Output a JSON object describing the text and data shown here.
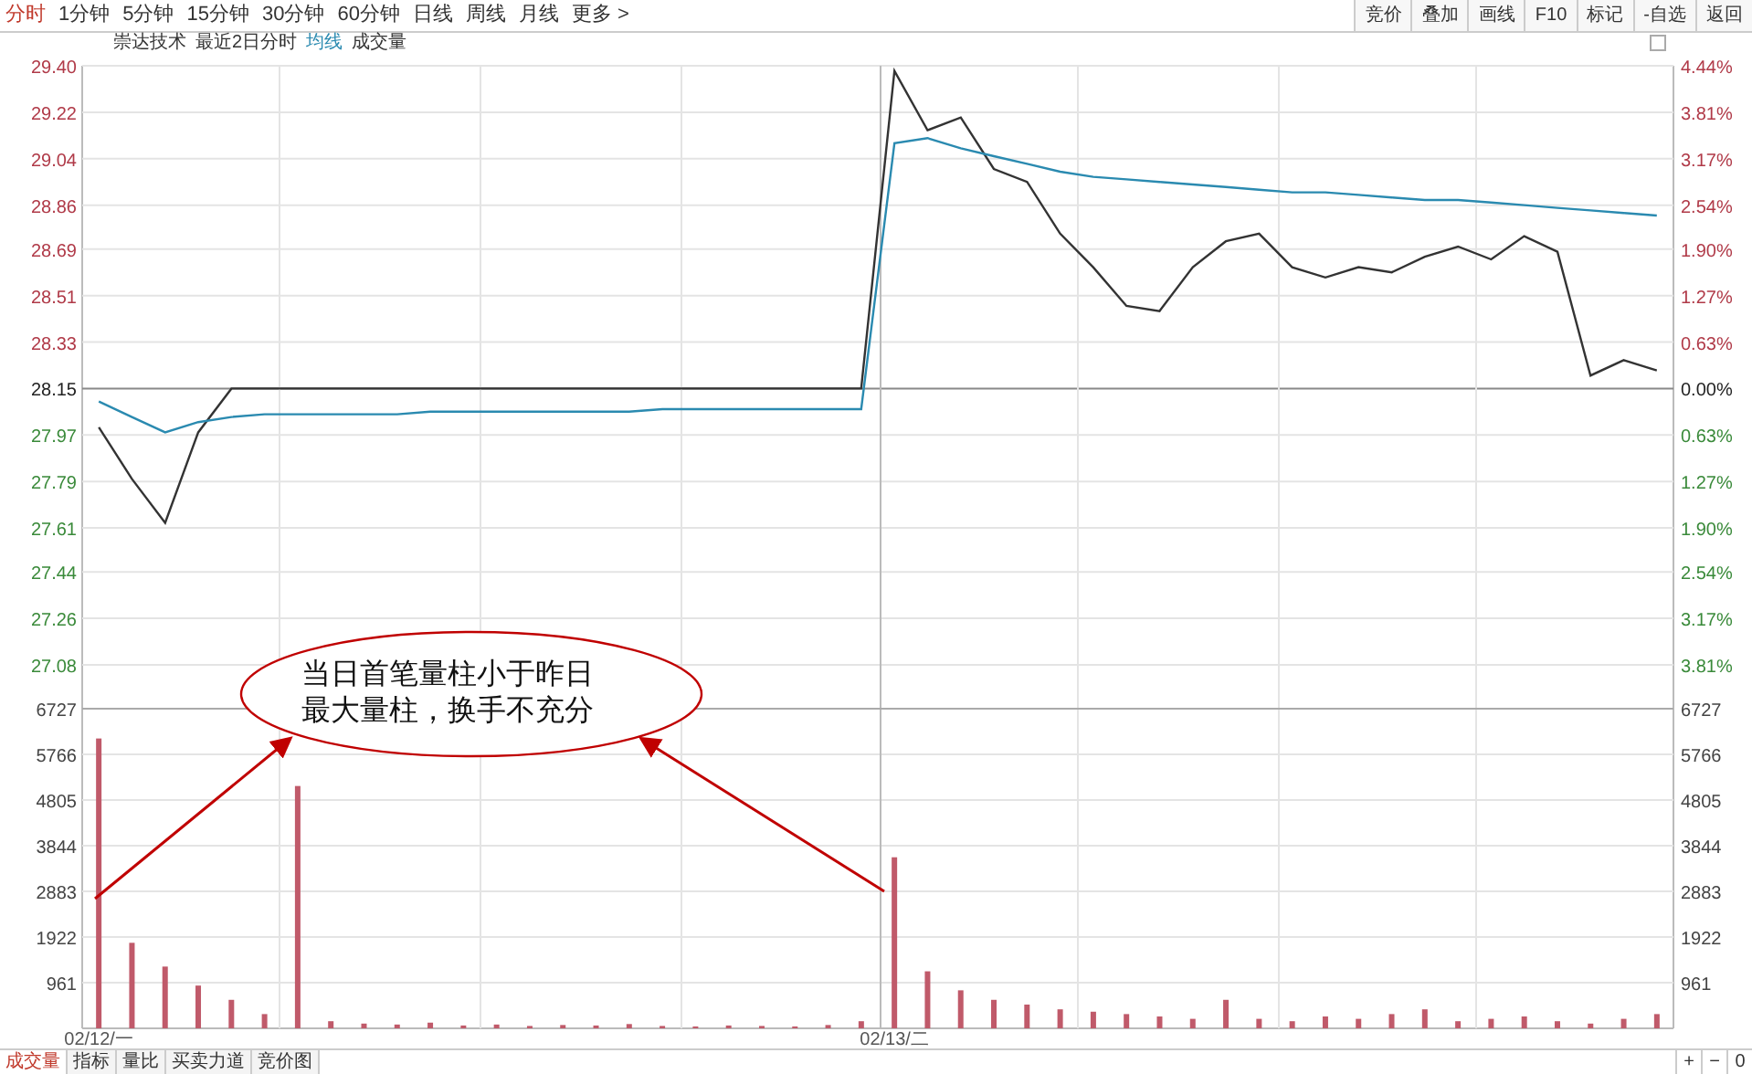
{
  "period_tabs": [
    {
      "label": "分时",
      "selected": true
    },
    {
      "label": "1分钟",
      "selected": false
    },
    {
      "label": "5分钟",
      "selected": false
    },
    {
      "label": "15分钟",
      "selected": false
    },
    {
      "label": "30分钟",
      "selected": false
    },
    {
      "label": "60分钟",
      "selected": false
    },
    {
      "label": "日线",
      "selected": false
    },
    {
      "label": "周线",
      "selected": false
    },
    {
      "label": "月线",
      "selected": false
    },
    {
      "label": "更多 >",
      "selected": false
    }
  ],
  "toolbar_buttons": [
    "竞价",
    "叠加",
    "画线",
    "F10",
    "标记",
    "-自选",
    "返回"
  ],
  "legend": [
    "崇达技术",
    "最近2日分时"
  ],
  "price_chart": {
    "chart_data": {
      "type": "line",
      "categories": [
        null,
        null,
        null,
        null,
        null,
        null,
        null,
        null,
        null,
        null,
        null,
        null,
        null,
        null,
        null,
        null,
        null,
        null,
        null,
        null,
        null,
        null,
        null,
        null,
        null,
        null,
        null,
        null,
        null,
        null,
        null,
        null,
        null,
        null,
        null,
        null,
        null,
        null,
        null,
        null,
        null,
        null,
        null,
        null,
        null,
        null,
        null,
        null
      ],
      "ylim": [
        26.91,
        29.4
      ],
      "yticks": [
        {
          "value": 29.4,
          "label": "29.40"
        },
        {
          "value": 29.22,
          "label": "29.22"
        },
        {
          "value": 29.04,
          "label": "29.04"
        },
        {
          "value": 28.86,
          "label": "28.86"
        },
        {
          "value": 28.69,
          "label": "28.69"
        },
        {
          "value": 28.51,
          "label": "28.51"
        },
        {
          "value": 28.33,
          "label": "28.33"
        },
        {
          "value": 28.15,
          "label": "28.15"
        },
        {
          "value": 27.97,
          "label": "27.97"
        },
        {
          "value": 27.79,
          "label": "27.79"
        },
        {
          "value": 27.61,
          "label": "27.61"
        },
        {
          "value": 27.44,
          "label": "27.44"
        },
        {
          "value": 27.26,
          "label": "27.26"
        },
        {
          "value": 27.08,
          "label": "27.08"
        }
      ],
      "series": [
        {
          "color": "#333333",
          "values": [
            28.0,
            27.8,
            27.63,
            27.98,
            28.15,
            28.15,
            28.15,
            28.15,
            28.15,
            28.15,
            28.15,
            28.15,
            28.15,
            28.15,
            28.15,
            28.15,
            28.15,
            28.15,
            28.15,
            28.15,
            28.15,
            28.15,
            28.15,
            28.15,
            29.38,
            29.15,
            29.2,
            29.0,
            28.95,
            28.75,
            28.62,
            28.47,
            28.45,
            28.62,
            28.72,
            28.75,
            28.62,
            28.58,
            28.62,
            28.6,
            28.66,
            28.7,
            28.65,
            28.74,
            28.68,
            28.2,
            28.26,
            28.22
          ]
        },
        {
          "name": "均线",
          "color": "#2a8ab0",
          "values": [
            28.1,
            28.04,
            27.98,
            28.02,
            28.04,
            28.05,
            28.05,
            28.05,
            28.05,
            28.05,
            28.06,
            28.06,
            28.06,
            28.06,
            28.06,
            28.06,
            28.06,
            28.07,
            28.07,
            28.07,
            28.07,
            28.07,
            28.07,
            28.07,
            29.1,
            29.12,
            29.08,
            29.05,
            29.02,
            28.99,
            28.97,
            28.96,
            28.95,
            28.94,
            28.93,
            28.92,
            28.91,
            28.91,
            28.9,
            28.89,
            28.88,
            28.88,
            28.87,
            28.86,
            28.85,
            28.84,
            28.83,
            28.82
          ]
        }
      ]
    },
    "right_labels": [
      {
        "text": "4.44%",
        "color": "#b03a48"
      },
      {
        "text": "3.81%",
        "color": "#b03a48"
      },
      {
        "text": "3.17%",
        "color": "#b03a48"
      },
      {
        "text": "2.54%",
        "color": "#b03a48"
      },
      {
        "text": "1.90%",
        "color": "#b03a48"
      },
      {
        "text": "1.27%",
        "color": "#b03a48"
      },
      {
        "text": "0.63%",
        "color": "#b03a48"
      },
      {
        "text": "0.00%",
        "color": "#222222"
      },
      {
        "text": "0.63%",
        "color": "#3a8a3a"
      },
      {
        "text": "1.27%",
        "color": "#3a8a3a"
      },
      {
        "text": "1.90%",
        "color": "#3a8a3a"
      },
      {
        "text": "2.54%",
        "color": "#3a8a3a"
      },
      {
        "text": "3.17%",
        "color": "#3a8a3a"
      },
      {
        "text": "3.81%",
        "color": "#3a8a3a"
      }
    ]
  },
  "volume_chart": {
    "chart_data": {
      "type": "bar",
      "categories": [
        "02/12/一",
        null,
        null,
        null,
        null,
        null,
        null,
        null,
        null,
        null,
        null,
        null,
        null,
        null,
        null,
        null,
        null,
        null,
        null,
        null,
        null,
        null,
        null,
        null,
        "02/13/二",
        null,
        null,
        null,
        null,
        null,
        null,
        null,
        null,
        null,
        null,
        null,
        null,
        null,
        null,
        null,
        null,
        null,
        null,
        null,
        null,
        null,
        null,
        null
      ],
      "ylim": [
        0,
        6727
      ],
      "yticks": [
        6727,
        5766,
        4805,
        3844,
        2883,
        1922,
        961
      ],
      "series": [
        {
          "name": "成交量",
          "color": "#c05a6a",
          "values": [
            6100,
            1800,
            1300,
            900,
            600,
            300,
            5100,
            150,
            100,
            80,
            120,
            60,
            80,
            50,
            70,
            60,
            90,
            50,
            40,
            60,
            50,
            40,
            70,
            150,
            3600,
            1200,
            800,
            600,
            500,
            400,
            350,
            300,
            250,
            200,
            600,
            200,
            150,
            250,
            200,
            300,
            400,
            150,
            200,
            250,
            150,
            100,
            200,
            300
          ]
        }
      ]
    },
    "right_labels": [
      "6727",
      "5766",
      "4805",
      "3844",
      "2883",
      "1922",
      "961"
    ]
  },
  "annotation": {
    "lines": [
      "当日首笔量柱小于昨日",
      "最大量柱，换手不充分"
    ]
  },
  "bottom_tabs": [
    {
      "label": "成交量",
      "selected": true
    },
    {
      "label": "指标",
      "selected": false
    },
    {
      "label": "量比",
      "selected": false
    },
    {
      "label": "买卖力道",
      "selected": false
    },
    {
      "label": "竞价图",
      "selected": false
    }
  ],
  "zoom_buttons": [
    "+",
    "−",
    "0"
  ]
}
